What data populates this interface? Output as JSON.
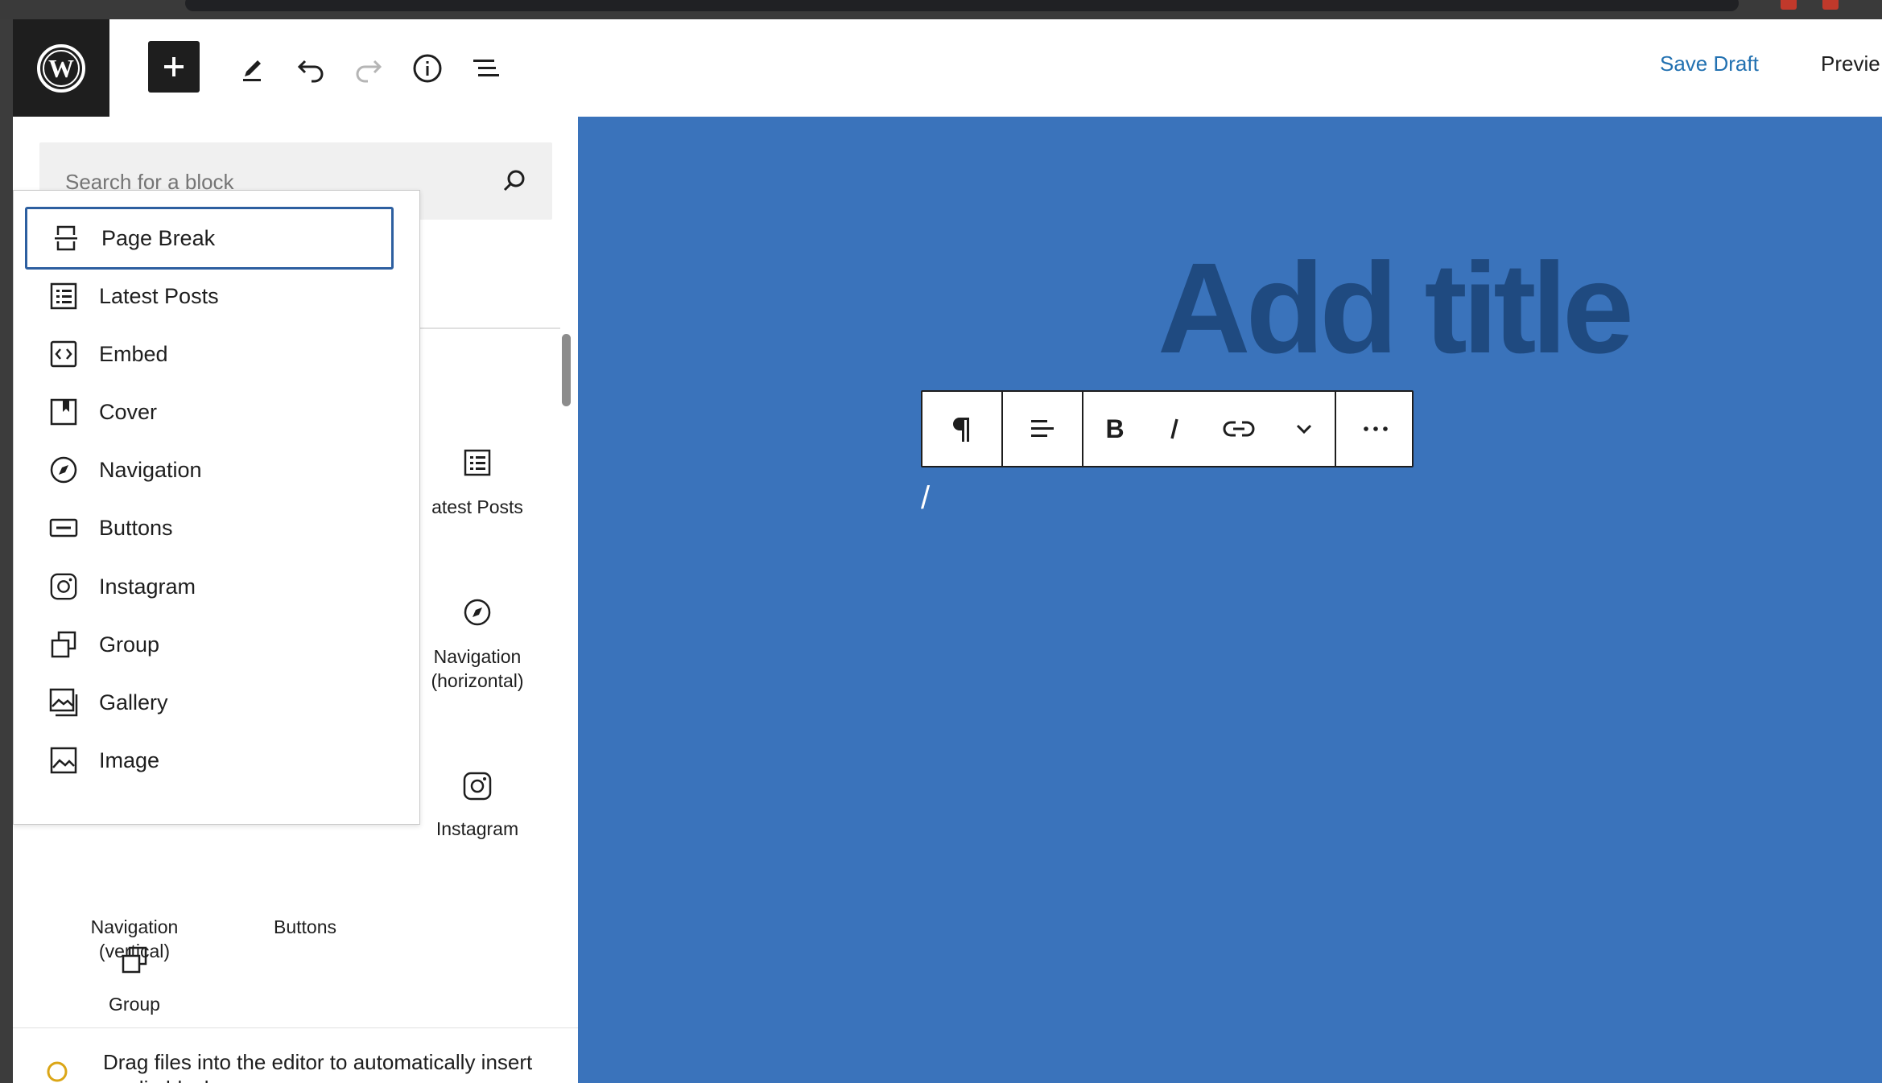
{
  "header": {
    "save_draft": "Save Draft",
    "preview": "Previe"
  },
  "inserter": {
    "search_placeholder": "Search for a block",
    "grid_items": [
      {
        "label": "atest Posts",
        "icon": "latest-posts-icon"
      },
      {
        "label": "Navigation\n(horizontal)",
        "icon": "navigation-icon"
      },
      {
        "label": "Navigation\n(vertical)",
        "icon": "navigation-icon"
      },
      {
        "label": "Buttons",
        "icon": "buttons-icon"
      },
      {
        "label": "Instagram",
        "icon": "instagram-icon"
      },
      {
        "label": "Group",
        "icon": "group-icon"
      }
    ],
    "tip": "Drag files into the editor to automatically insert media blocks."
  },
  "autocomplete": {
    "items": [
      {
        "label": "Page Break",
        "icon": "page-break-icon",
        "selected": true
      },
      {
        "label": "Latest Posts",
        "icon": "latest-posts-icon"
      },
      {
        "label": "Embed",
        "icon": "embed-icon"
      },
      {
        "label": "Cover",
        "icon": "cover-icon"
      },
      {
        "label": "Navigation",
        "icon": "navigation-icon"
      },
      {
        "label": "Buttons",
        "icon": "buttons-icon"
      },
      {
        "label": "Instagram",
        "icon": "instagram-icon"
      },
      {
        "label": "Group",
        "icon": "group-icon"
      },
      {
        "label": "Gallery",
        "icon": "gallery-icon"
      },
      {
        "label": "Image",
        "icon": "image-icon"
      }
    ]
  },
  "canvas": {
    "title_placeholder": "Add title",
    "slash_text": "/"
  },
  "colors": {
    "canvas_bg": "#3a73bb",
    "title": "#1f4a80",
    "accent": "#2271b1",
    "selected_border": "#2d5fa0"
  }
}
